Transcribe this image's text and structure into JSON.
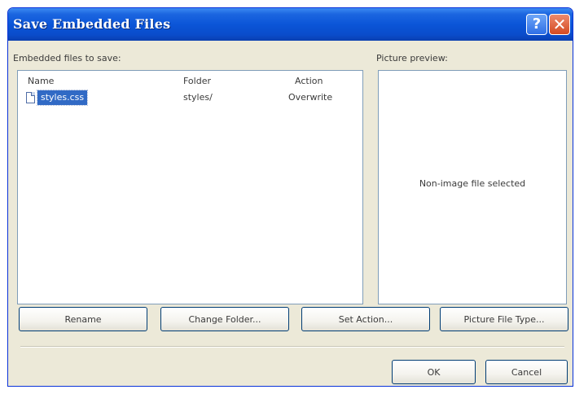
{
  "window": {
    "title": "Save Embedded Files",
    "help_glyph": "?",
    "close_glyph": "✕"
  },
  "files_section": {
    "label": "Embedded files to save:",
    "columns": [
      "Name",
      "Folder",
      "Action"
    ],
    "rows": [
      {
        "name": "styles.css",
        "folder": "styles/",
        "action": "Overwrite",
        "selected": true
      }
    ]
  },
  "preview_section": {
    "label": "Picture preview:",
    "message": "Non-image file selected"
  },
  "action_buttons": {
    "rename": "Rename",
    "change_folder": "Change Folder...",
    "set_action": "Set Action...",
    "picture_file_type": "Picture File Type..."
  },
  "footer_buttons": {
    "ok": "OK",
    "cancel": "Cancel"
  },
  "colors": {
    "titlebar": "#0b55d8",
    "selection": "#316ac5",
    "dialog_bg": "#ece9d8",
    "close_button": "#d44a22"
  },
  "icons": {
    "file": "document-icon",
    "help": "help-icon",
    "close": "close-icon"
  }
}
